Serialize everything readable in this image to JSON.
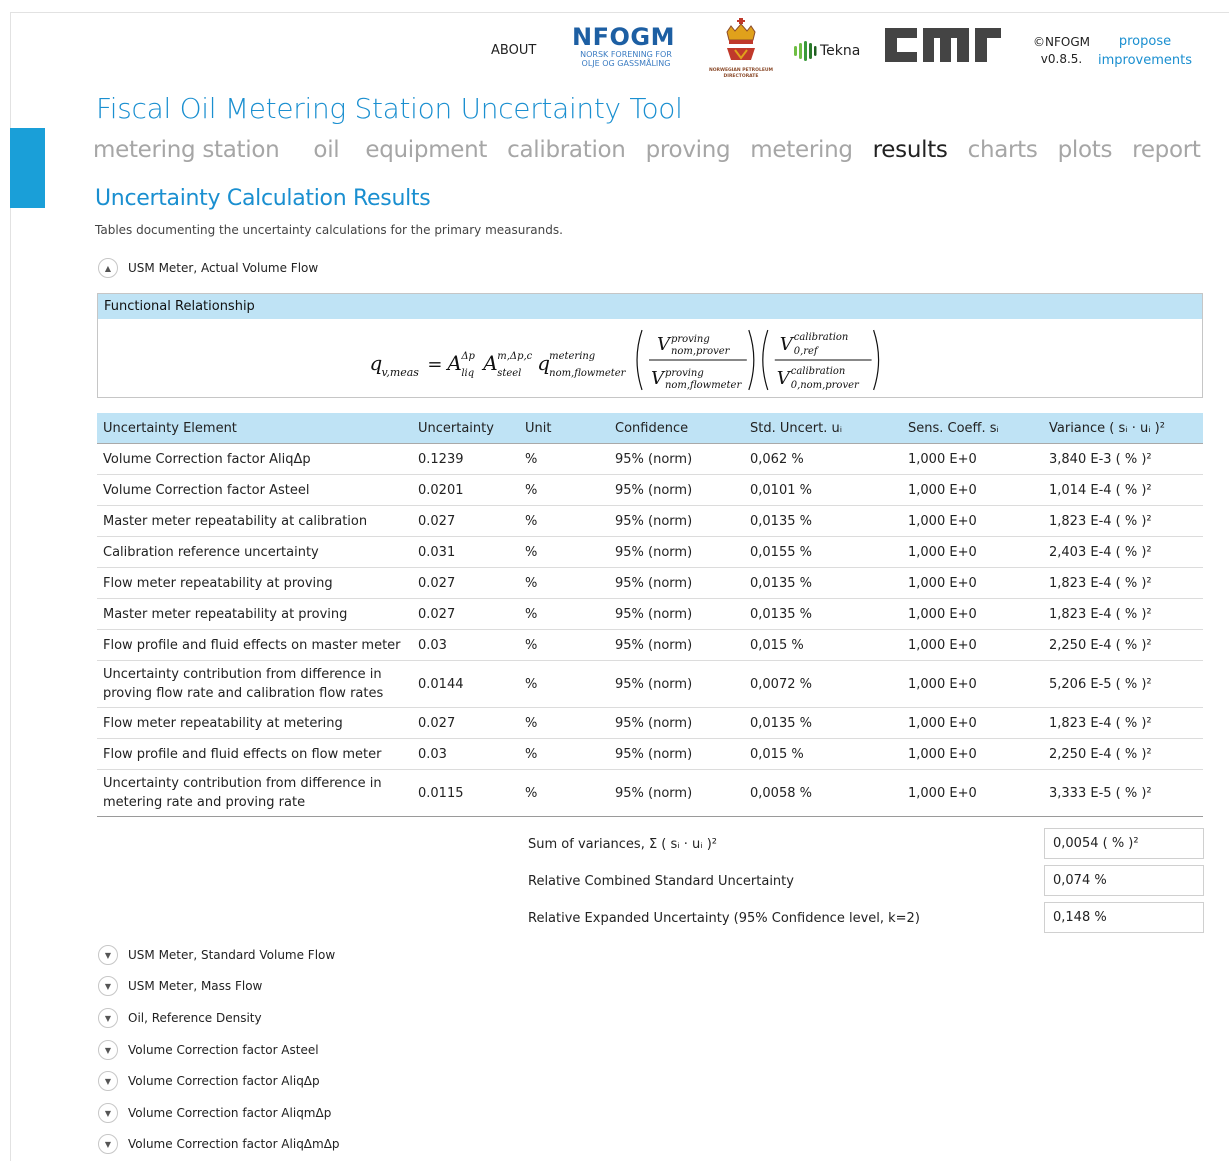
{
  "header": {
    "about": "ABOUT",
    "nfogm_logo": "NFOGM",
    "nfogm_sub": "NORSK FORENING FOR OLJE OG GASSMÅLING",
    "npd_sub": "NORWEGIAN PETROLEUM DIRECTORATE",
    "tekna": "Tekna",
    "cmr": "cmr",
    "copyright": "©NFOGM",
    "version": "v0.8.5.",
    "propose_line1": "propose",
    "propose_line2": "improvements"
  },
  "app_title": "Fiscal Oil Metering Station Uncertainty Tool",
  "nav": {
    "tabs": [
      "metering station",
      "oil",
      "equipment",
      "calibration",
      "proving",
      "metering",
      "results",
      "charts",
      "plots",
      "report"
    ],
    "active": "results"
  },
  "section": {
    "title": "Uncertainty Calculation Results",
    "description": "Tables documenting the uncertainty calculations for the primary measurands."
  },
  "expanded_panel": {
    "label": "USM Meter, Actual Volume Flow",
    "functional_relationship_title": "Functional Relationship"
  },
  "table": {
    "headers": [
      "Uncertainty Element",
      "Uncertainty",
      "Unit",
      "Confidence",
      "Std. Uncert. uᵢ",
      "Sens. Coeff. sᵢ",
      "Variance ( sᵢ · uᵢ )²"
    ],
    "rows": [
      [
        "Volume Correction factor AliqΔp",
        "0.1239",
        "%",
        "95% (norm)",
        "0,062  %",
        "1,000 E+0",
        "3,840 E-3  ( % )²"
      ],
      [
        "Volume Correction factor Asteel",
        "0.0201",
        "%",
        "95% (norm)",
        "0,0101  %",
        "1,000 E+0",
        "1,014 E-4  ( % )²"
      ],
      [
        "Master meter repeatability at calibration",
        "0.027",
        "%",
        "95% (norm)",
        "0,0135  %",
        "1,000 E+0",
        "1,823 E-4  ( % )²"
      ],
      [
        "Calibration reference uncertainty",
        "0.031",
        "%",
        "95% (norm)",
        "0,0155  %",
        "1,000 E+0",
        "2,403 E-4  ( % )²"
      ],
      [
        "Flow meter repeatability at proving",
        "0.027",
        "%",
        "95% (norm)",
        "0,0135  %",
        "1,000 E+0",
        "1,823 E-4  ( % )²"
      ],
      [
        "Master meter repeatability at proving",
        "0.027",
        "%",
        "95% (norm)",
        "0,0135  %",
        "1,000 E+0",
        "1,823 E-4  ( % )²"
      ],
      [
        "Flow profile and fluid effects on master meter",
        "0.03",
        "%",
        "95% (norm)",
        "0,015  %",
        "1,000 E+0",
        "2,250 E-4  ( % )²"
      ],
      [
        "Uncertainty contribution from difference in proving flow rate and calibration flow rates",
        "0.0144",
        "%",
        "95% (norm)",
        "0,0072  %",
        "1,000 E+0",
        "5,206 E-5  ( % )²"
      ],
      [
        "Flow meter repeatability at metering",
        "0.027",
        "%",
        "95% (norm)",
        "0,0135  %",
        "1,000 E+0",
        "1,823 E-4  ( % )²"
      ],
      [
        "Flow profile and fluid effects on flow meter",
        "0.03",
        "%",
        "95% (norm)",
        "0,015  %",
        "1,000 E+0",
        "2,250 E-4  ( % )²"
      ],
      [
        "Uncertainty contribution from difference in metering rate and proving rate",
        "0.0115",
        "%",
        "95% (norm)",
        "0,0058  %",
        "1,000 E+0",
        "3,333 E-5  ( % )²"
      ]
    ]
  },
  "summary": {
    "sum_label": "Sum of variances, Σ ( sᵢ · uᵢ )²",
    "sum_value": "0,0054  ( % )²",
    "combined_label": "Relative Combined Standard Uncertainty",
    "combined_value": "0,074  %",
    "expanded_label": "Relative Expanded Uncertainty (95% Confidence level, k=2)",
    "expanded_value": "0,148  %"
  },
  "collapsed_panels": [
    "USM Meter, Standard Volume Flow",
    "USM Meter, Mass Flow",
    "Oil, Reference Density",
    "Volume Correction factor Asteel",
    "Volume Correction factor AliqΔp",
    "Volume Correction factor AliqmΔp",
    "Volume Correction factor AliqΔmΔp"
  ],
  "colors": {
    "accent": "#1a8fd0",
    "header_bg": "#bfe3f5",
    "side_bar": "#1a9fd8"
  }
}
